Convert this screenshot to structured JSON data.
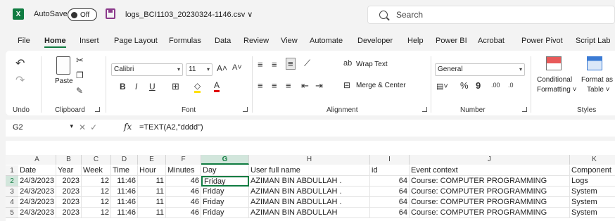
{
  "titlebar": {
    "app_icon": "X",
    "autosave_label": "AutoSave",
    "toggle_state": "Off",
    "filename": "logs_BCI1103_20230324-1146.csv ∨",
    "search_placeholder": "Search"
  },
  "menu": [
    "File",
    "Home",
    "Insert",
    "Page Layout",
    "Formulas",
    "Data",
    "Review",
    "View",
    "Automate",
    "Developer",
    "Help",
    "Power BI",
    "Acrobat",
    "Power Pivot",
    "Script Lab"
  ],
  "ribbon": {
    "undo_label": "Undo",
    "clipboard_label": "Clipboard",
    "paste_label": "Paste",
    "font_label": "Font",
    "font_name": "Calibri",
    "font_size": "11",
    "alignment_label": "Alignment",
    "wrap_text": "Wrap Text",
    "merge_center": "Merge & Center",
    "number_label": "Number",
    "number_format": "General",
    "styles_label": "Styles",
    "conditional_formatting": "Conditional",
    "conditional_formatting_2": "Formatting ˅",
    "format_as_table": "Format as",
    "format_as_table_2": "Table ˅"
  },
  "formula_bar": {
    "name_box": "G2",
    "fx": "fx",
    "formula": "=TEXT(A2,\"dddd\")"
  },
  "columns": [
    "A",
    "B",
    "C",
    "D",
    "E",
    "F",
    "G",
    "H",
    "I",
    "J",
    "K"
  ],
  "rows": [
    [
      "Date",
      "Year",
      "Week",
      "Time",
      "Hour",
      "Minutes",
      "Day",
      "User full name",
      "id",
      "Event context",
      "Component"
    ],
    [
      "24/3/2023",
      "2023",
      "12",
      "11:46",
      "11",
      "46",
      "Friday",
      "AZIMAN BIN ABDULLAH .",
      "64",
      "Course: COMPUTER PROGRAMMING",
      "Logs"
    ],
    [
      "24/3/2023",
      "2023",
      "12",
      "11:46",
      "11",
      "46",
      "Friday",
      "AZIMAN BIN ABDULLAH .",
      "64",
      "Course: COMPUTER PROGRAMMING",
      "System"
    ],
    [
      "24/3/2023",
      "2023",
      "12",
      "11:46",
      "11",
      "46",
      "Friday",
      "AZIMAN BIN ABDULLAH .",
      "64",
      "Course: COMPUTER PROGRAMMING",
      "System"
    ],
    [
      "24/3/2023",
      "2023",
      "12",
      "11:46",
      "11",
      "46",
      "Friday",
      "AZIMAN BIN ABDULLAH",
      "64",
      "Course: COMPUTER PROGRAMMING",
      "System"
    ]
  ],
  "row_numbers": [
    "1",
    "2",
    "3",
    "4",
    "5"
  ],
  "selected_cell": "G2",
  "accent_color": "#107c41"
}
